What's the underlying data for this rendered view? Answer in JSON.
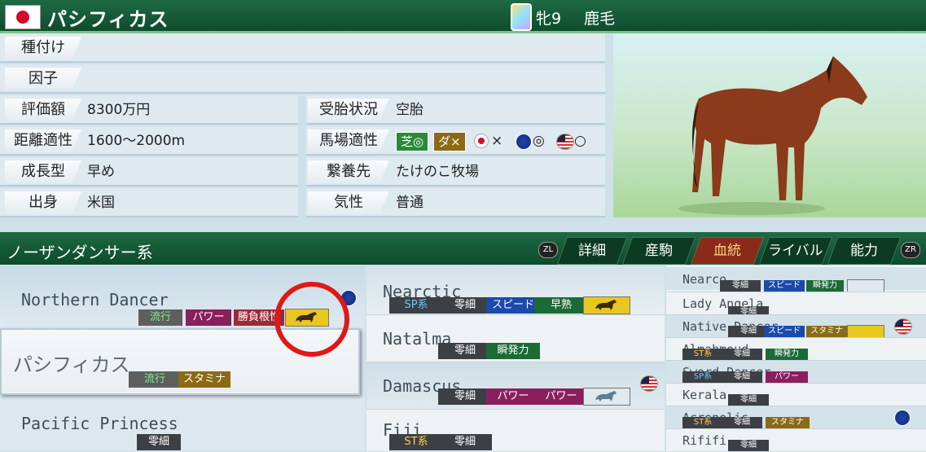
{
  "header": {
    "horse_name": "パシフィカス",
    "sex_age": "牝9",
    "coat": "鹿毛"
  },
  "info": {
    "rows_left": [
      {
        "label": "種付け",
        "value": ""
      },
      {
        "label": "因子",
        "value": ""
      },
      {
        "label": "評価額",
        "value": "8300万円"
      },
      {
        "label": "距離適性",
        "value": "1600〜2000m"
      },
      {
        "label": "成長型",
        "value": "早め"
      },
      {
        "label": "出身",
        "value": "米国"
      }
    ],
    "rows_right": [
      {
        "label": "受胎状況",
        "value": "空胎"
      },
      {
        "label": "馬場適性",
        "value": ""
      },
      {
        "label": "繋養先",
        "value": "たけのこ牧場"
      },
      {
        "label": "気性",
        "value": "普通"
      }
    ],
    "track": {
      "turf": "芝◎",
      "dirt": "ダ×",
      "jp_mark": "×",
      "eu_mark": "◎",
      "us_mark": "○"
    }
  },
  "pedigree": {
    "title": "ノーザンダンサー系",
    "btn_left": "ZL",
    "btn_right": "ZR",
    "tabs": [
      "詳細",
      "産駒",
      "血統",
      "ライバル",
      "能力"
    ],
    "active_tab": "血統",
    "col1": [
      {
        "name": "Northern Dancer",
        "tags": [
          "流行",
          "パワー",
          "勝負根性"
        ]
      },
      {
        "name": "パシフィカス",
        "tags": [
          "流行",
          "スタミナ"
        ]
      },
      {
        "name": "Pacific Princess",
        "tags": [
          "零細"
        ]
      }
    ],
    "col2": [
      {
        "name": "Nearctic",
        "tags": [
          "SP系",
          "零細",
          "スピード",
          "早熟"
        ]
      },
      {
        "name": "Natalma",
        "tags": [
          "零細",
          "瞬発力"
        ]
      },
      {
        "name": "Damascus",
        "tags": [
          "零細",
          "パワー",
          "パワー"
        ]
      },
      {
        "name": "Fiji",
        "tags": [
          "ST系",
          "零細"
        ]
      }
    ],
    "col3": [
      {
        "name": "Nearco",
        "tags": [
          "零細",
          "スピード",
          "瞬発力"
        ]
      },
      {
        "name": "Lady Angela",
        "tags": [
          "零細"
        ]
      },
      {
        "name": "Native Dancer",
        "tags": [
          "零細",
          "スピード",
          "スタミナ"
        ]
      },
      {
        "name": "Almahmoud",
        "tags": [
          "ST系",
          "零細",
          "瞬発力"
        ]
      },
      {
        "name": "Sword Dancer",
        "tags": [
          "SP系",
          "零細",
          "パワー"
        ]
      },
      {
        "name": "Kerala",
        "tags": [
          "零細"
        ]
      },
      {
        "name": "Acropolis",
        "tags": [
          "ST系",
          "零細",
          "スタミナ"
        ]
      },
      {
        "name": "Rififi",
        "tags": [
          "零細"
        ]
      }
    ]
  }
}
